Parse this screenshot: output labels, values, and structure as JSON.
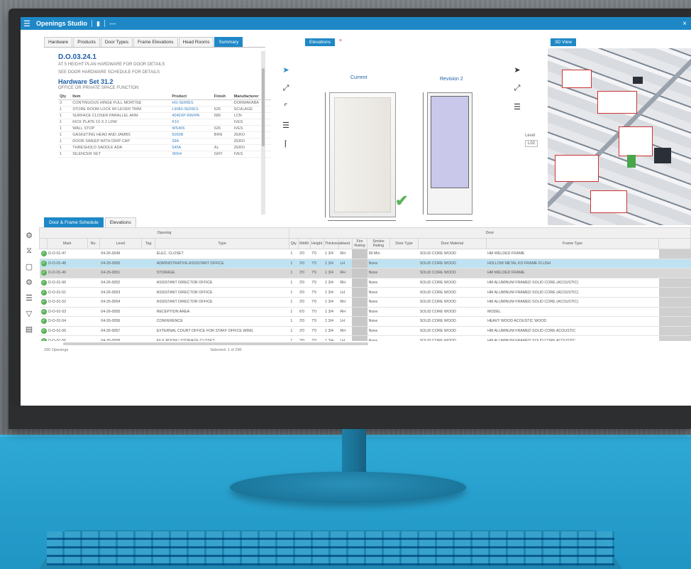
{
  "window": {
    "app_title": "Openings Studio",
    "tab_label": "—",
    "close_label": "×"
  },
  "left_panel": {
    "tabs": [
      "Hardware",
      "Products",
      "Door Types",
      "Frame Elevations",
      "Head Rooms",
      "Summary"
    ],
    "active_tab": 5,
    "opening_title": "D.O.03.24.1",
    "opening_subtitle": "AT 5 HEIGHT PLAN HARDWARE FOR DOOR DETAILS",
    "desc_line": "SEE DOOR HARDWARE SCHEDULE FOR DETAILS",
    "hardware_set_title": "Hardware Set 31.2",
    "hardware_set_sub": "OFFICE OR PRIVATE SPACE FUNCTION",
    "columns": [
      "Qty",
      "Item",
      "Product",
      "Finish",
      "Manufacturer"
    ],
    "rows": [
      {
        "qty": "3",
        "item": "CONTINUOUS HINGE FULL MORTISE",
        "product": "HG-SERIES",
        "finish": "",
        "mfr": "DORMAKABA"
      },
      {
        "qty": "1",
        "item": "STORE ROOM LOCK W/ LEVER TRIM",
        "product": "L9080-SERIES",
        "finish": "626",
        "mfr": "SCHLAGE"
      },
      {
        "qty": "1",
        "item": "SURFACE CLOSER PARALLEL ARM",
        "product": "4040XP-RW/PA",
        "finish": "689",
        "mfr": "LCN"
      },
      {
        "qty": "1",
        "item": "KICK PLATE 10 X 2 LDW",
        "product": "K10",
        "finish": "",
        "mfr": "IVES"
      },
      {
        "qty": "1",
        "item": "WALL STOP",
        "product": "WS406",
        "finish": "626",
        "mfr": "IVES"
      },
      {
        "qty": "1",
        "item": "GASKETING HEAD AND JAMBS",
        "product": "5050B",
        "finish": "BRN",
        "mfr": "ZERO"
      },
      {
        "qty": "1",
        "item": "DOOR SWEEP WITH DRIP CAP",
        "product": "39A",
        "finish": "",
        "mfr": "ZERO"
      },
      {
        "qty": "1",
        "item": "THRESHOLD SADDLE ADA",
        "product": "545A",
        "finish": "AL",
        "mfr": "ZERO"
      },
      {
        "qty": "1",
        "item": "SILENCER SET",
        "product": "SR64",
        "finish": "GRY",
        "mfr": "IVES"
      }
    ]
  },
  "mid_panel": {
    "tab_label": "Elevations",
    "tab_close": "×",
    "current_label": "Current",
    "review_label": "Revision 2",
    "check_mark": "✔",
    "splitter": "•••"
  },
  "right_panel": {
    "tab_label": "3D View",
    "side_label": "Level",
    "side_value": "L02"
  },
  "bottom": {
    "tabs": [
      "Door & Frame Schedule",
      "Elevations"
    ],
    "active_tab": 0,
    "group_headers": {
      "opening": "Opening",
      "door": "Door"
    },
    "columns": [
      "Mark",
      "No.",
      "Level",
      "Tag",
      "Type",
      "Qty",
      "Width",
      "Height",
      "Thickness",
      "Hand",
      "Fire Rating",
      "Smoke Rating",
      "Door Type",
      "Door Material",
      "Frame Type"
    ],
    "rows": [
      {
        "mark": "D-O-01-47",
        "no": "04-26-0049",
        "level": "30",
        "desc": "ELEC. CLOSET",
        "qty": "1",
        "w": "3'0",
        "h": "7'0",
        "t": "1 3/4",
        "hand": "RH",
        "fire": "90 Min",
        "smoke": "",
        "type": "SOLID CORE WOOD",
        "mat": "HM WELDED FRAME",
        "sel": false,
        "grey": false
      },
      {
        "mark": "D-O-01-48",
        "no": "04-26-0050",
        "level": "30",
        "desc": "ADMINISTRATIVE ASSISTANT OFFICE",
        "qty": "1",
        "w": "3'0",
        "h": "7'0",
        "t": "1 3/4",
        "hand": "LH",
        "fire": "None",
        "smoke": "",
        "type": "SOLID CORE WOOD",
        "mat": "HOLLOW METAL KD FRAME FLUSH",
        "sel": true,
        "grey": false
      },
      {
        "mark": "D-O-01-49",
        "no": "04-26-0051",
        "level": "30",
        "desc": "STORAGE",
        "qty": "1",
        "w": "3'0",
        "h": "7'0",
        "t": "1 3/4",
        "hand": "RH",
        "fire": "None",
        "smoke": "",
        "type": "SOLID CORE WOOD",
        "mat": "HM WELDED FRAME",
        "sel": false,
        "grey": true
      },
      {
        "mark": "D-O-01-50",
        "no": "04-26-0052",
        "level": "30",
        "desc": "ASSISTANT DIRECTOR OFFICE",
        "qty": "1",
        "w": "3'0",
        "h": "7'0",
        "t": "1 3/4",
        "hand": "RH",
        "fire": "None",
        "smoke": "",
        "type": "SOLID CORE WOOD",
        "mat": "HM ALUMINUM FRAMED SOLID CORE (ACOUSTIC)",
        "sel": false,
        "grey": false
      },
      {
        "mark": "D-O-01-51",
        "no": "04-26-0053",
        "level": "30",
        "desc": "ASSISTANT DIRECTOR OFFICE",
        "qty": "1",
        "w": "3'0",
        "h": "7'0",
        "t": "1 3/4",
        "hand": "LH",
        "fire": "None",
        "smoke": "",
        "type": "SOLID CORE WOOD",
        "mat": "HM ALUMINUM FRAMED SOLID CORE (ACOUSTIC)",
        "sel": false,
        "grey": false
      },
      {
        "mark": "D-O-01-52",
        "no": "04-26-0054",
        "level": "30",
        "desc": "ASSISTANT DIRECTOR OFFICE",
        "qty": "1",
        "w": "3'0",
        "h": "7'0",
        "t": "1 3/4",
        "hand": "RH",
        "fire": "None",
        "smoke": "",
        "type": "SOLID CORE WOOD",
        "mat": "HM ALUMINUM FRAMED SOLID CORE (ACOUSTIC)",
        "sel": false,
        "grey": false
      },
      {
        "mark": "D-O-01-53",
        "no": "04-26-0055",
        "level": "31",
        "desc": "RECEPTION AREA",
        "qty": "1",
        "w": "6'0",
        "h": "7'0",
        "t": "1 3/4",
        "hand": "RH",
        "fire": "None",
        "smoke": "",
        "type": "SOLID CORE WOOD",
        "mat": "MODEL",
        "sel": false,
        "grey": false
      },
      {
        "mark": "D-O-01-54",
        "no": "04-26-0056",
        "level": "31",
        "desc": "CONFERENCE",
        "qty": "1",
        "w": "3'0",
        "h": "7'0",
        "t": "1 3/4",
        "hand": "LH",
        "fire": "None",
        "smoke": "",
        "type": "SOLID CORE WOOD",
        "mat": "HEAVY WOOD ACOUSTIC WOOD",
        "sel": false,
        "grey": false
      },
      {
        "mark": "D-O-01-55",
        "no": "04-26-0057",
        "level": "31",
        "desc": "EXTERNAL COURT OFFICE FOR STAFF OFFICE WING",
        "qty": "1",
        "w": "3'0",
        "h": "7'0",
        "t": "1 3/4",
        "hand": "RH",
        "fire": "None",
        "smoke": "",
        "type": "SOLID CORE WOOD",
        "mat": "HM ALUMINUM FRAMED SOLID CORE ACOUSTIC",
        "sel": false,
        "grey": false
      },
      {
        "mark": "D-O-01-56",
        "no": "04-26-0058",
        "level": "31",
        "desc": "FILE ROOM / STORAGE CLOSET",
        "qty": "1",
        "w": "3'0",
        "h": "7'0",
        "t": "1 3/4",
        "hand": "LH",
        "fire": "None",
        "smoke": "",
        "type": "SOLID CORE WOOD",
        "mat": "HM ALUMINUM FRAMED SOLID CORE ACOUSTIC",
        "sel": false,
        "grey": false
      },
      {
        "mark": "D-O-01-57",
        "no": "04-26-0059",
        "level": "31",
        "desc": "PRIVATE CORRIDOR TO BUSINESS OFFICE SUITE",
        "qty": "1",
        "w": "3'0",
        "h": "7'0",
        "t": "1 3/4",
        "hand": "RH",
        "fire": "None",
        "smoke": "",
        "type": "SOLID CORE WOOD",
        "mat": "ALUMINUM FRAMED SOLID CORE ACOUSTIC FULL LITE DOOR",
        "sel": false,
        "grey": false
      },
      {
        "mark": "D-O-01-58",
        "no": "04-26-0060",
        "level": "31",
        "desc": "OFFICE",
        "qty": "1",
        "w": "3'0",
        "h": "7'0",
        "t": "1 3/4",
        "hand": "LH",
        "fire": "None",
        "smoke": "",
        "type": "SOLID CORE WOOD",
        "mat": "HM ALUMINUM FRAMED SOLID CORE ACOUSTIC",
        "sel": false,
        "grey": false
      }
    ],
    "footer_left": "290 Openings",
    "footer_mid": "Selected: 1 of 290"
  },
  "colors": {
    "accent": "#1e88c7",
    "desk": "#2aa3d1",
    "ok": "#5bb35a",
    "selected_row": "#bfe2f2"
  },
  "icons": {
    "side": [
      "settings-icon",
      "filter-icon",
      "folder-icon",
      "gear-icon",
      "list-icon",
      "funnel-icon",
      "print-icon"
    ]
  }
}
